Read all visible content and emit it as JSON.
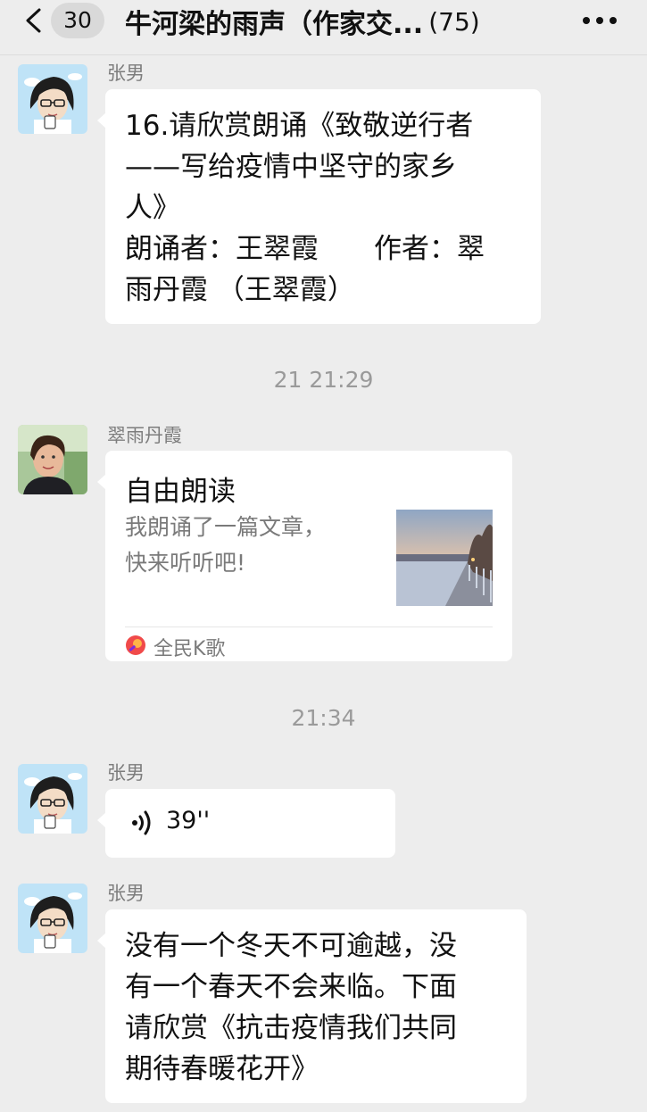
{
  "header": {
    "back_icon": "chevron-left-icon",
    "unread_count": "30",
    "title": "牛河梁的雨声（作家交...",
    "member_count": "(75)",
    "more_icon": "more-dots-icon"
  },
  "messages": [
    {
      "sender": "张男",
      "text": "16.请欣赏朗诵《致敬逆行者\n——写给疫情中坚守的家乡\n人》\n朗诵者：王翠霞　　作者：翠\n雨丹霞 （王翠霞）"
    },
    {
      "timestamp": "21 21:29"
    },
    {
      "sender": "翠雨丹霞",
      "card": {
        "title": "自由朗读",
        "description": "我朗诵了一篇文章，\n快来听听吧!",
        "source": "全民K歌",
        "source_icon": "karaoke-app-icon",
        "thumbnail": "riverside-walkway-photo"
      }
    },
    {
      "timestamp": "21:34"
    },
    {
      "sender": "张男",
      "voice": {
        "icon": "voice-wave-icon",
        "duration": "39''"
      }
    },
    {
      "sender": "张男",
      "text": "没有一个冬天不可逾越，没\n有一个春天不会来临。下面\n请欣赏《抗击疫情我们共同\n期待春暖花开》"
    }
  ]
}
